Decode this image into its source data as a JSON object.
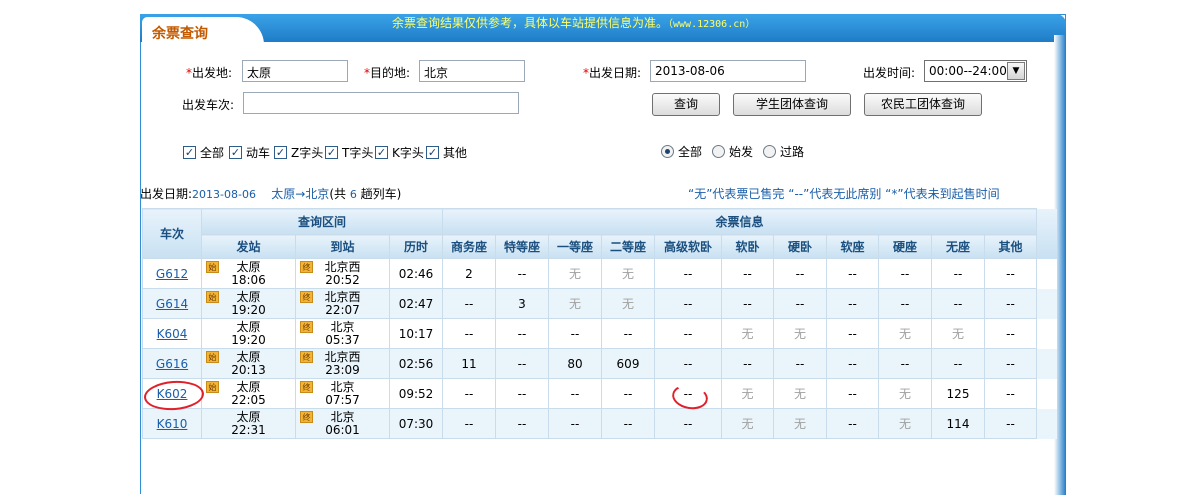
{
  "header": {
    "tab_title": "余票查询",
    "notice": "余票查询结果仅供参考，具体以车站提供信息为准。",
    "notice_url": "（www.12306.cn）"
  },
  "form": {
    "from_label": "出发地:",
    "from_value": "太原",
    "to_label": "目的地:",
    "to_value": "北京",
    "date_label": "出发日期:",
    "date_value": "2013-08-06",
    "time_label": "出发时间:",
    "time_value": "00:00--24:00",
    "train_label": "出发车次:",
    "train_value": "",
    "query_button": "查询",
    "student_button": "学生团体查询",
    "worker_button": "农民工团体查询",
    "required_mark": "*",
    "filters": [
      {
        "label": "全部",
        "checked": true
      },
      {
        "label": "动车",
        "checked": true
      },
      {
        "label": "Z字头",
        "checked": true
      },
      {
        "label": "T字头",
        "checked": true
      },
      {
        "label": "K字头",
        "checked": true
      },
      {
        "label": "其他",
        "checked": true
      }
    ],
    "station_types": [
      {
        "label": "全部",
        "selected": true
      },
      {
        "label": "始发",
        "selected": false
      },
      {
        "label": "过路",
        "selected": false
      }
    ]
  },
  "summary": {
    "date_label": "出发日期:",
    "date_value": "2013-08-06",
    "route": "太原→北京",
    "count_prefix": "(共",
    "count": "6",
    "count_suffix": "趟列车)"
  },
  "legend": "“无”代表票已售完  “--”代表无此席别  “*”代表未到起售时间",
  "table": {
    "col_train": "车次",
    "group_range": "查询区间",
    "group_tickets": "余票信息",
    "col_depart": "发站",
    "col_arrive": "到站",
    "col_duration": "历时",
    "seat_columns": [
      "商务座",
      "特等座",
      "一等座",
      "二等座",
      "高级软卧",
      "软卧",
      "硬卧",
      "软座",
      "硬座",
      "无座",
      "其他"
    ],
    "badge_origin": "始",
    "badge_pass": "终",
    "rows": [
      {
        "code": "G612",
        "from": "太原",
        "dep": "18:06",
        "to": "北京西",
        "arr": "20:52",
        "dur": "02:46",
        "origin": true,
        "seats": [
          "2",
          "--",
          "无",
          "无",
          "--",
          "--",
          "--",
          "--",
          "--",
          "--",
          "--"
        ]
      },
      {
        "code": "G614",
        "from": "太原",
        "dep": "19:20",
        "to": "北京西",
        "arr": "22:07",
        "dur": "02:47",
        "origin": true,
        "seats": [
          "--",
          "3",
          "无",
          "无",
          "--",
          "--",
          "--",
          "--",
          "--",
          "--",
          "--"
        ]
      },
      {
        "code": "K604",
        "from": "太原",
        "dep": "19:20",
        "to": "北京",
        "arr": "05:37",
        "dur": "10:17",
        "origin": false,
        "seats": [
          "--",
          "--",
          "--",
          "--",
          "--",
          "无",
          "无",
          "--",
          "无",
          "无",
          "--"
        ]
      },
      {
        "code": "G616",
        "from": "太原",
        "dep": "20:13",
        "to": "北京西",
        "arr": "23:09",
        "dur": "02:56",
        "origin": true,
        "seats": [
          "11",
          "--",
          "80",
          "609",
          "--",
          "--",
          "--",
          "--",
          "--",
          "--",
          "--"
        ]
      },
      {
        "code": "K602",
        "from": "太原",
        "dep": "22:05",
        "to": "北京",
        "arr": "07:57",
        "dur": "09:52",
        "origin": true,
        "seats": [
          "--",
          "--",
          "--",
          "--",
          "--",
          "无",
          "无",
          "--",
          "无",
          "125",
          "--"
        ]
      },
      {
        "code": "K610",
        "from": "太原",
        "dep": "22:31",
        "to": "北京",
        "arr": "06:01",
        "dur": "07:30",
        "origin": false,
        "seats": [
          "--",
          "--",
          "--",
          "--",
          "--",
          "无",
          "无",
          "--",
          "无",
          "114",
          "--"
        ]
      }
    ]
  },
  "colors": {
    "accent": "#1f7cc7",
    "tab_title": "#c45a00",
    "notice": "#ffff66",
    "link": "#1a5ea8",
    "annotation": "#e0202a"
  }
}
